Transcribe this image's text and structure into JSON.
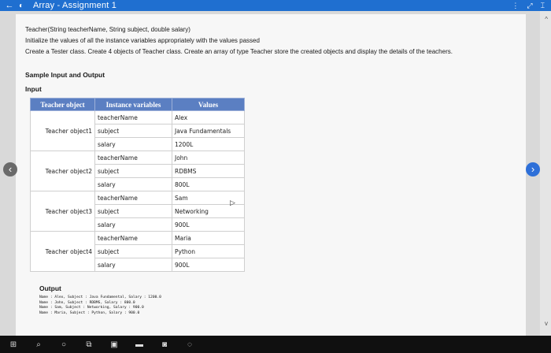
{
  "window": {
    "title": "Array - Assignment 1",
    "back_glyph": "←",
    "more_glyph": "⋮",
    "expand_glyph": "⤢",
    "menu_glyph": "⌶"
  },
  "task": {
    "line1": "Teacher(String teacherName, String subject, double salary)",
    "line2": "Initialize the values of all the instance variables appropriately with the values passed",
    "line3": "Create a Tester class. Create 4 objects of Teacher class. Create an array of type Teacher store the created objects and display the details of the teachers."
  },
  "sample": {
    "title": "Sample Input and Output",
    "input_label": "Input",
    "output_label": "Output"
  },
  "table": {
    "headers": [
      "Teacher object",
      "Instance variables",
      "Values"
    ],
    "rows": [
      {
        "object": "Teacher object1",
        "vars": [
          "teacherName",
          "subject",
          "salary"
        ],
        "vals": [
          "Alex",
          "Java Fundamentals",
          "1200L"
        ]
      },
      {
        "object": "Teacher object2",
        "vars": [
          "teacherName",
          "subject",
          "salary"
        ],
        "vals": [
          "John",
          "RDBMS",
          "800L"
        ]
      },
      {
        "object": "Teacher object3",
        "vars": [
          "teacherName",
          "subject",
          "salary"
        ],
        "vals": [
          "Sam",
          "Networking",
          "900L"
        ]
      },
      {
        "object": "Teacher object4",
        "vars": [
          "teacherName",
          "subject",
          "salary"
        ],
        "vals": [
          "Maria",
          "Python",
          "900L"
        ]
      }
    ]
  },
  "output_lines": [
    "Name : Alex, Subject : Java Fundamental, Salary : 1200.0",
    "Name : John, Subject : RDBMS, Salary : 800.0",
    "Name : Sam, Subject : Networking, Salary : 900.0",
    "Name : Maria, Subject : Python, Salary : 900.0"
  ],
  "nav": {
    "prev": "‹",
    "next": "›"
  },
  "scroll": {
    "up": "^",
    "down": "v"
  },
  "taskbar": {
    "icons": [
      "windows-icon",
      "search-icon",
      "cortana-icon",
      "task-view-icon",
      "store-icon",
      "file-explorer-icon",
      "photos-icon",
      "edge-icon"
    ]
  }
}
